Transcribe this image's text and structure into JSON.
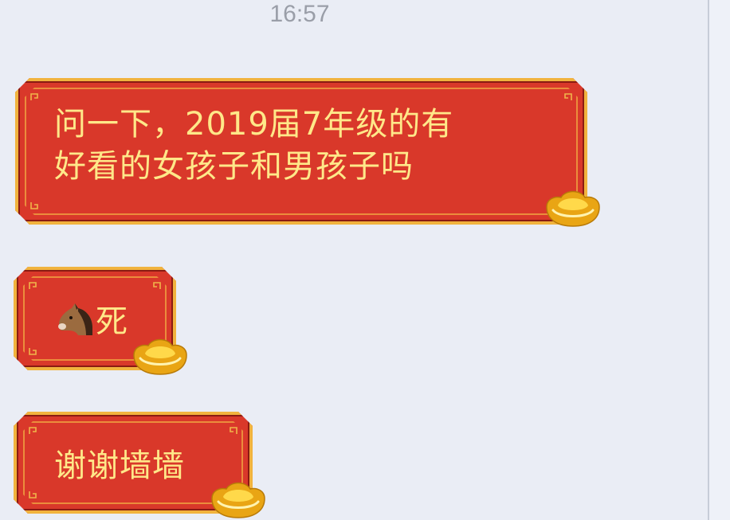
{
  "chat": {
    "timestamp": "16:57",
    "messages": [
      {
        "line1": "问一下，2019届7年级的有",
        "line2": "好看的女孩子和男孩子吗"
      },
      {
        "emoji": "horse-face",
        "text": "死"
      },
      {
        "text": "谢谢墙墙"
      }
    ]
  },
  "theme": {
    "background": "#eaedf5",
    "bubble_fill": "#d9382a",
    "bubble_border": "#f1b33e",
    "bubble_text": "#ffe889",
    "timestamp_color": "#9a9ea8"
  }
}
